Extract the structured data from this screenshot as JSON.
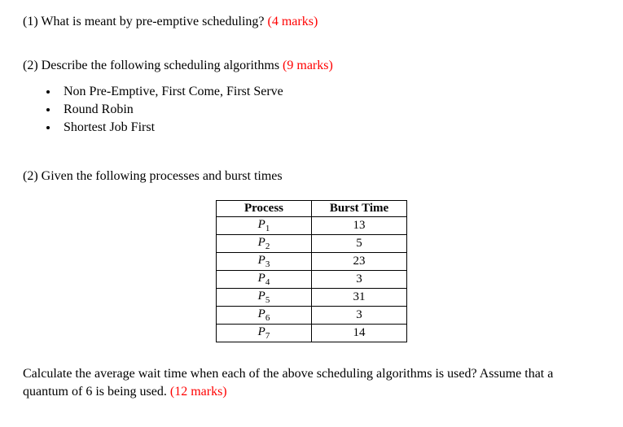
{
  "q1": {
    "prefix": "(1) ",
    "text": "What is meant by pre-emptive scheduling? ",
    "marks": "(4 marks)"
  },
  "q2": {
    "prefix": "(2) ",
    "text": "Describe the following scheduling algorithms ",
    "marks": "(9 marks)",
    "items": [
      "Non Pre-Emptive, First Come, First Serve",
      "Round Robin",
      "Shortest Job First"
    ]
  },
  "q3": {
    "prefix": "(2) ",
    "text": "Given the following processes and burst times"
  },
  "table": {
    "headers": [
      "Process",
      "Burst Time"
    ],
    "rows": [
      {
        "p": "P",
        "n": "1",
        "burst": "13"
      },
      {
        "p": "P",
        "n": "2",
        "burst": "5"
      },
      {
        "p": "P",
        "n": "3",
        "burst": "23"
      },
      {
        "p": "P",
        "n": "4",
        "burst": "3"
      },
      {
        "p": "P",
        "n": "5",
        "burst": "31"
      },
      {
        "p": "P",
        "n": "6",
        "burst": "3"
      },
      {
        "p": "P",
        "n": "7",
        "burst": "14"
      }
    ]
  },
  "final": {
    "text": "Calculate the average wait time when each of the above scheduling algorithms is used? Assume that a quantum of 6 is being used. ",
    "marks": "(12 marks)"
  }
}
